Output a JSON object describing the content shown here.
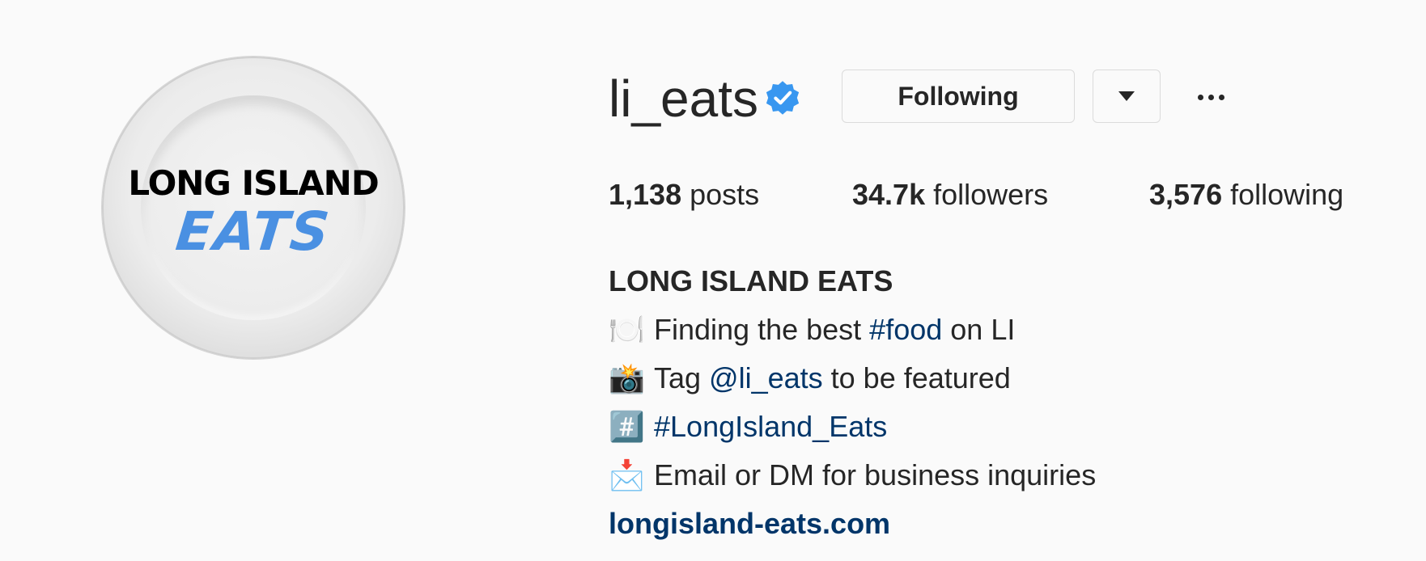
{
  "avatar": {
    "logo_line1": "LONG ISLAND",
    "logo_line2": "EATS",
    "logo_accent_color": "#4a90e2"
  },
  "header": {
    "username": "li_eats",
    "verified_icon": "verified-badge-icon",
    "verified_color": "#3897f0",
    "following_button_label": "Following",
    "dropdown_icon": "chevron-down-icon",
    "more_icon": "more-options-icon"
  },
  "stats": {
    "posts": {
      "count": "1,138",
      "label": "posts"
    },
    "followers": {
      "count": "34.7k",
      "label": "followers"
    },
    "following": {
      "count": "3,576",
      "label": "following"
    }
  },
  "bio": {
    "name": "LONG ISLAND EATS",
    "line1": {
      "emoji": "🍽️",
      "before": "Finding the best ",
      "hashtag": "#food",
      "after": " on LI"
    },
    "line2": {
      "emoji": "📸",
      "before": "Tag ",
      "mention": "@li_eats",
      "after": " to be featured"
    },
    "line3": {
      "emoji": "#️⃣",
      "hashtag": "#LongIsland_Eats"
    },
    "line4": {
      "emoji": "📩",
      "text": "Email or DM for business inquiries"
    },
    "website": "longisland-eats.com"
  },
  "colors": {
    "link": "#003569",
    "text": "#262626",
    "background": "#fafafa",
    "border": "#dbdbdb"
  }
}
